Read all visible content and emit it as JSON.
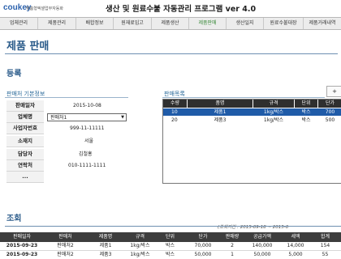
{
  "app": {
    "logo": "coukey",
    "logo_sub": "맞춤형엑셀업무자동화",
    "title": "생산 및 원료수불 자동관리 프로그램 ver 4.0"
  },
  "menu": [
    {
      "label": "업체관리",
      "active": false
    },
    {
      "label": "제품관리",
      "active": false
    },
    {
      "label": "배합정보",
      "active": false
    },
    {
      "label": "원재료입고",
      "active": false
    },
    {
      "label": "제품생산",
      "active": false
    },
    {
      "label": "제품판매",
      "active": true
    },
    {
      "label": "생산일지",
      "active": false
    },
    {
      "label": "원료수불대장",
      "active": false
    },
    {
      "label": "제품거래내역",
      "active": false
    }
  ],
  "page": {
    "title": "제품 판매",
    "register_heading": "등록",
    "client_info_heading": "판매처 기본정보",
    "product_list_heading": "판매목록",
    "query_heading": "조회",
    "date_range": "(조회기간 : 2015-09-18 ~ 2015-0"
  },
  "form": {
    "sale_date_label": "판매일자",
    "sale_date_value": "2015-10-08",
    "company_label": "업체명",
    "company_value": "판매처1",
    "biz_no_label": "사업자번호",
    "biz_no_value": "999-11-11111",
    "location_label": "소재지",
    "location_value": "서울",
    "manager_label": "담당자",
    "manager_value": "김철홍",
    "contact_label": "연락처",
    "contact_value": "010-1111-1111",
    "extra_label": "..."
  },
  "plus_button": "+",
  "product_grid": {
    "headers": [
      "수량",
      "품명",
      "규격",
      "단위",
      "단가"
    ],
    "rows": [
      [
        "10",
        "제품1",
        "1kg/박스",
        "박스",
        "700"
      ],
      [
        "20",
        "제품3",
        "1kg/박스",
        "박스",
        "500"
      ]
    ]
  },
  "query_table": {
    "headers": [
      "판매일자",
      "판매처",
      "제품명",
      "규격",
      "단위",
      "단가",
      "판매량",
      "공급가액",
      "세액",
      "합계"
    ],
    "rows": [
      [
        "2015-09-23",
        "판매처2",
        "제품1",
        "1kg/박스",
        "박스",
        "70,000",
        "2",
        "140,000",
        "14,000",
        "154"
      ],
      [
        "2015-09-23",
        "판매처2",
        "제품3",
        "1kg/박스",
        "박스",
        "50,000",
        "1",
        "50,000",
        "5,000",
        "55"
      ]
    ]
  }
}
